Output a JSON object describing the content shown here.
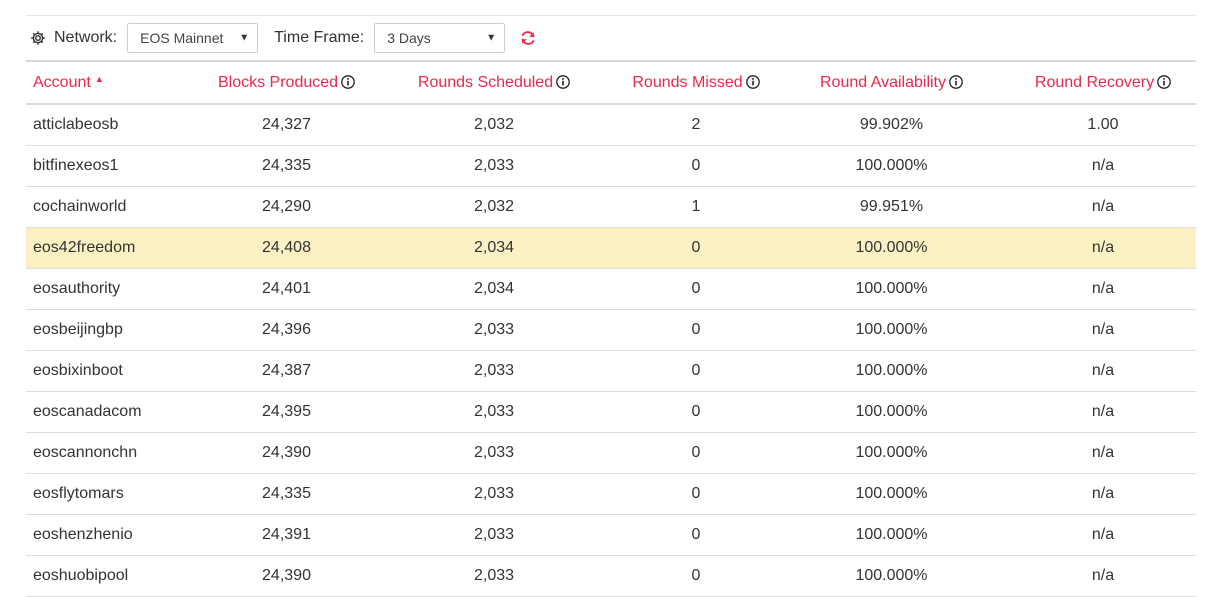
{
  "toolbar": {
    "network_label": "Network:",
    "network_value": "EOS Mainnet",
    "timeframe_label": "Time Frame:",
    "timeframe_value": "3 Days",
    "gear_icon": "gear-icon",
    "refresh_icon": "refresh-icon"
  },
  "colors": {
    "accent": "#e8294b",
    "highlight_row": "#fcf1c3"
  },
  "table": {
    "columns": [
      "Account",
      "Blocks Produced",
      "Rounds Scheduled",
      "Rounds Missed",
      "Round Availability",
      "Round Recovery"
    ],
    "sorted_column": "Account",
    "sort_direction": "ascending",
    "highlighted_account": "eos42freedom",
    "rows": [
      [
        "atticlabeosb",
        "24,327",
        "2,032",
        "2",
        "99.902%",
        "1.00"
      ],
      [
        "bitfinexeos1",
        "24,335",
        "2,033",
        "0",
        "100.000%",
        "n/a"
      ],
      [
        "cochainworld",
        "24,290",
        "2,032",
        "1",
        "99.951%",
        "n/a"
      ],
      [
        "eos42freedom",
        "24,408",
        "2,034",
        "0",
        "100.000%",
        "n/a"
      ],
      [
        "eosauthority",
        "24,401",
        "2,034",
        "0",
        "100.000%",
        "n/a"
      ],
      [
        "eosbeijingbp",
        "24,396",
        "2,033",
        "0",
        "100.000%",
        "n/a"
      ],
      [
        "eosbixinboot",
        "24,387",
        "2,033",
        "0",
        "100.000%",
        "n/a"
      ],
      [
        "eoscanadacom",
        "24,395",
        "2,033",
        "0",
        "100.000%",
        "n/a"
      ],
      [
        "eoscannonchn",
        "24,390",
        "2,033",
        "0",
        "100.000%",
        "n/a"
      ],
      [
        "eosflytomars",
        "24,335",
        "2,033",
        "0",
        "100.000%",
        "n/a"
      ],
      [
        "eoshenzhenio",
        "24,391",
        "2,033",
        "0",
        "100.000%",
        "n/a"
      ],
      [
        "eoshuobipool",
        "24,390",
        "2,033",
        "0",
        "100.000%",
        "n/a"
      ]
    ]
  }
}
